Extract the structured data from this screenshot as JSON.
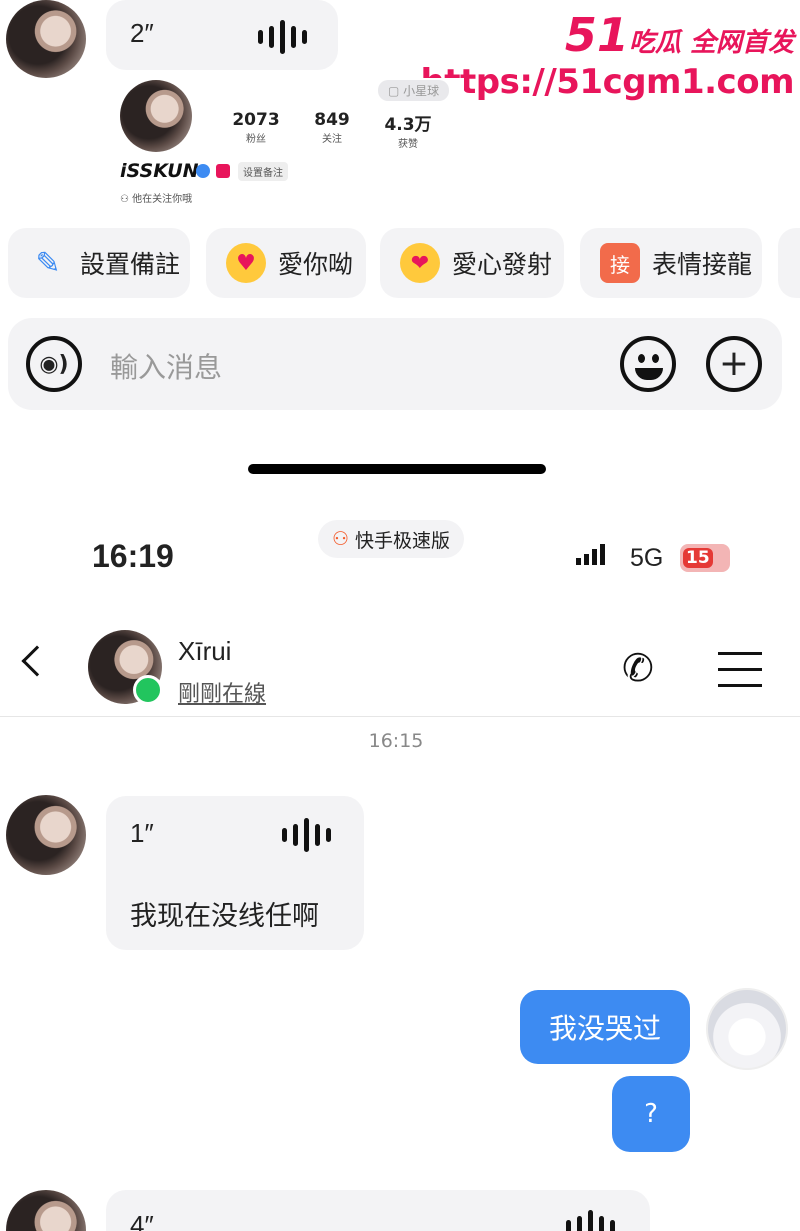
{
  "watermark": {
    "num": "51",
    "brand": "吃瓜 全网首发",
    "url": "https://51cgm1.com"
  },
  "top_voice": {
    "duration": "2″"
  },
  "profile_card": {
    "badge": "小星球",
    "stats": [
      {
        "value": "2073",
        "label": "粉丝"
      },
      {
        "value": "849",
        "label": "关注"
      },
      {
        "value": "4.3万",
        "label": "获赞"
      }
    ],
    "username": "iSSKUN",
    "remark_btn": "设置备注",
    "follow_note": "他在关注你哦"
  },
  "quick_actions": [
    {
      "label": "設置備註",
      "icon": "pencil-icon"
    },
    {
      "label": "愛你呦",
      "icon": "heart-eyes-icon"
    },
    {
      "label": "愛心發射",
      "icon": "love-shoot-icon"
    },
    {
      "label": "表情接龍",
      "icon": "jie-icon",
      "icon_text": "接"
    }
  ],
  "input": {
    "placeholder": "輸入消息"
  },
  "status_bar": {
    "time": "16:19",
    "app": "快手极速版",
    "network": "5G",
    "battery": "15"
  },
  "chat_header": {
    "name": "Xīrui",
    "status": "剛剛在線"
  },
  "timestamp": "16:15",
  "messages": [
    {
      "from": "other",
      "duration": "1″",
      "text": "我现在没线任啊"
    },
    {
      "from": "me",
      "text": "我没哭过"
    },
    {
      "from": "me",
      "text": "?"
    },
    {
      "from": "other",
      "duration": "4″"
    }
  ],
  "colors": {
    "accent_blue": "#3d8bf2",
    "watermark": "#e8155b",
    "online": "#22c55e"
  }
}
